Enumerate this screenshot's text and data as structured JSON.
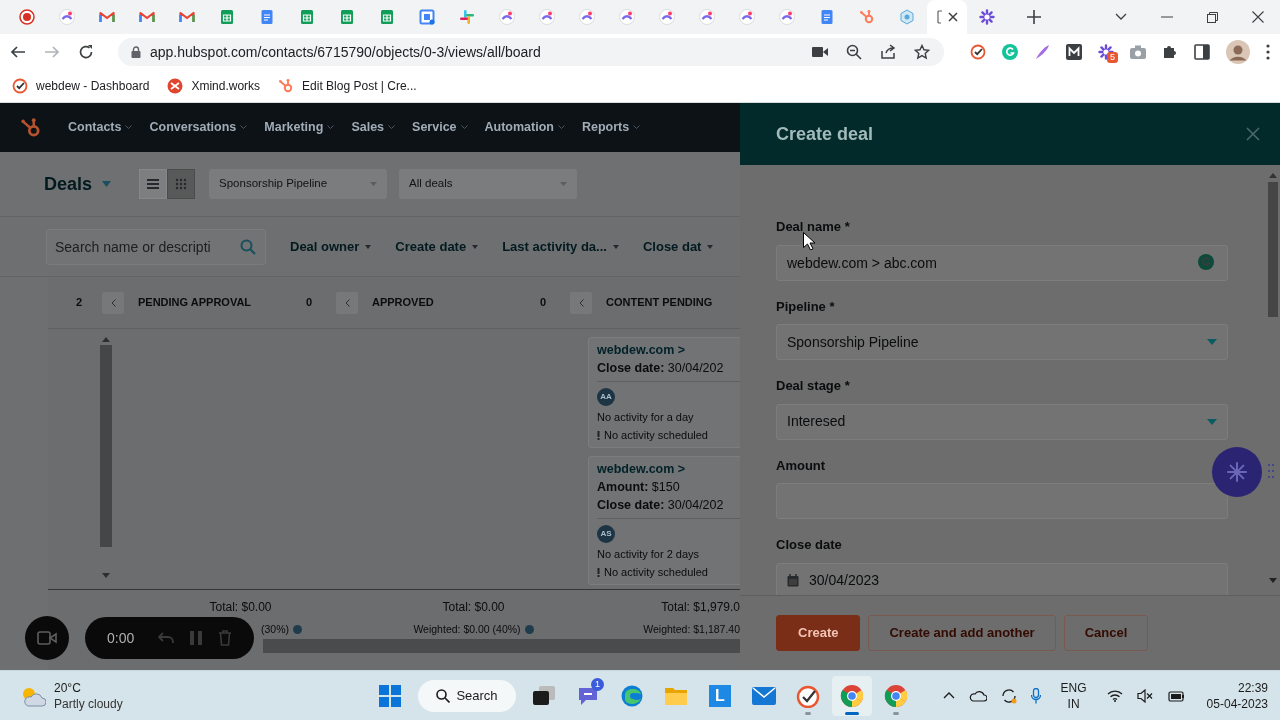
{
  "browser": {
    "tabs": [
      {
        "kind": "record",
        "selected": false
      },
      {
        "kind": "clickup",
        "selected": false
      },
      {
        "kind": "gmail",
        "selected": false
      },
      {
        "kind": "gmail",
        "selected": false
      },
      {
        "kind": "gmail",
        "selected": false
      },
      {
        "kind": "sheets",
        "selected": false
      },
      {
        "kind": "docs",
        "selected": false
      },
      {
        "kind": "sheets",
        "selected": false
      },
      {
        "kind": "sheets",
        "selected": false
      },
      {
        "kind": "sheets",
        "selected": false
      },
      {
        "kind": "calendar",
        "selected": false
      },
      {
        "kind": "slack",
        "selected": false
      },
      {
        "kind": "clickup",
        "selected": false
      },
      {
        "kind": "clickup",
        "selected": false
      },
      {
        "kind": "clickup",
        "selected": false
      },
      {
        "kind": "clickup",
        "selected": false
      },
      {
        "kind": "clickup",
        "selected": false
      },
      {
        "kind": "clickup",
        "selected": false
      },
      {
        "kind": "clickup",
        "selected": false
      },
      {
        "kind": "clickup",
        "selected": false
      },
      {
        "kind": "docs",
        "selected": false
      },
      {
        "kind": "hubspot",
        "selected": false
      },
      {
        "kind": "shield",
        "selected": false
      },
      {
        "kind": "page",
        "selected": true
      },
      {
        "kind": "gear",
        "selected": false
      }
    ],
    "url": "app.hubspot.com/contacts/6715790/objects/0-3/views/all/board",
    "extension_badge": "5",
    "bookmarks": [
      {
        "kind": "check",
        "label": "webdew - Dashboard"
      },
      {
        "kind": "xmind",
        "label": "Xmind.works"
      },
      {
        "kind": "hubspot",
        "label": "Edit Blog Post | Cre..."
      }
    ]
  },
  "app": {
    "nav": [
      "Contacts",
      "Conversations",
      "Marketing",
      "Sales",
      "Service",
      "Automation",
      "Reports"
    ],
    "title": "Deals",
    "view_modes": [
      {
        "kind": "list",
        "selected": false
      },
      {
        "kind": "board",
        "selected": true
      }
    ],
    "pipeline": "Sponsorship Pipeline",
    "view": "All deals",
    "search_placeholder": "Search name or descripti",
    "filters": [
      "Deal owner",
      "Create date",
      "Last activity da...",
      "Close dat"
    ],
    "columns": [
      {
        "count": "2"
      },
      {
        "name": "PENDING APPROVAL",
        "count": "0",
        "total": "Total: $0.00",
        "weighted": "(30%)"
      },
      {
        "name": "APPROVED",
        "count": "0",
        "total": "Total: $0.00",
        "weighted": "Weighted: $0.00 (40%)"
      },
      {
        "name": "CONTENT PENDING",
        "total": "Total: $1,979.0",
        "weighted": "Weighted: $1,187.40",
        "cards": [
          {
            "title": "webdew.com >",
            "lines": [
              {
                "label": "Close date:",
                "value": "30/04/202"
              }
            ],
            "avatar": "AA",
            "activity": "No activity for a day",
            "scheduled": "No activity scheduled"
          },
          {
            "title": "webdew.com >",
            "lines": [
              {
                "label": "Amount:",
                "value": "$150"
              },
              {
                "label": "Close date:",
                "value": "30/04/202"
              }
            ],
            "avatar": "AS",
            "activity": "No activity for 2 days",
            "scheduled": "No activity scheduled"
          }
        ]
      }
    ]
  },
  "recorder": {
    "time": "0:00"
  },
  "panel": {
    "title": "Create deal",
    "fields": [
      {
        "kind": "text",
        "label": "Deal name *",
        "value": "webdew.com > abc.com"
      },
      {
        "kind": "select",
        "label": "Pipeline *",
        "value": "Sponsorship Pipeline"
      },
      {
        "kind": "select",
        "label": "Deal stage *",
        "value": "Interesed"
      },
      {
        "kind": "text",
        "label": "Amount"
      },
      {
        "kind": "date",
        "label": "Close date",
        "value": "30/04/2023"
      }
    ],
    "buttons": [
      {
        "kind": "primary",
        "label": "Create"
      },
      {
        "kind": "secondary",
        "label": "Create and add another"
      },
      {
        "kind": "secondary",
        "label": "Cancel"
      }
    ]
  },
  "taskbar": {
    "temperature": "20°C",
    "weather": "Partly cloudy",
    "search": "Search",
    "apps": [
      {
        "kind": "start",
        "running": false,
        "selected": false
      },
      {
        "kind": "taskview",
        "running": false,
        "selected": false
      },
      {
        "kind": "chat",
        "running": false,
        "selected": false,
        "badge": "1"
      },
      {
        "kind": "edge",
        "running": false,
        "selected": false
      },
      {
        "kind": "explorer",
        "running": false,
        "selected": false
      },
      {
        "kind": "letter",
        "running": false,
        "selected": false,
        "label": "L"
      },
      {
        "kind": "mail",
        "running": false,
        "selected": false
      },
      {
        "kind": "check",
        "running": true,
        "selected": false
      },
      {
        "kind": "chrome",
        "running": true,
        "selected": true
      },
      {
        "kind": "chrome",
        "running": true,
        "selected": false
      }
    ],
    "language": "ENG",
    "region": "IN",
    "time": "22:39",
    "date": "05-04-2023"
  }
}
